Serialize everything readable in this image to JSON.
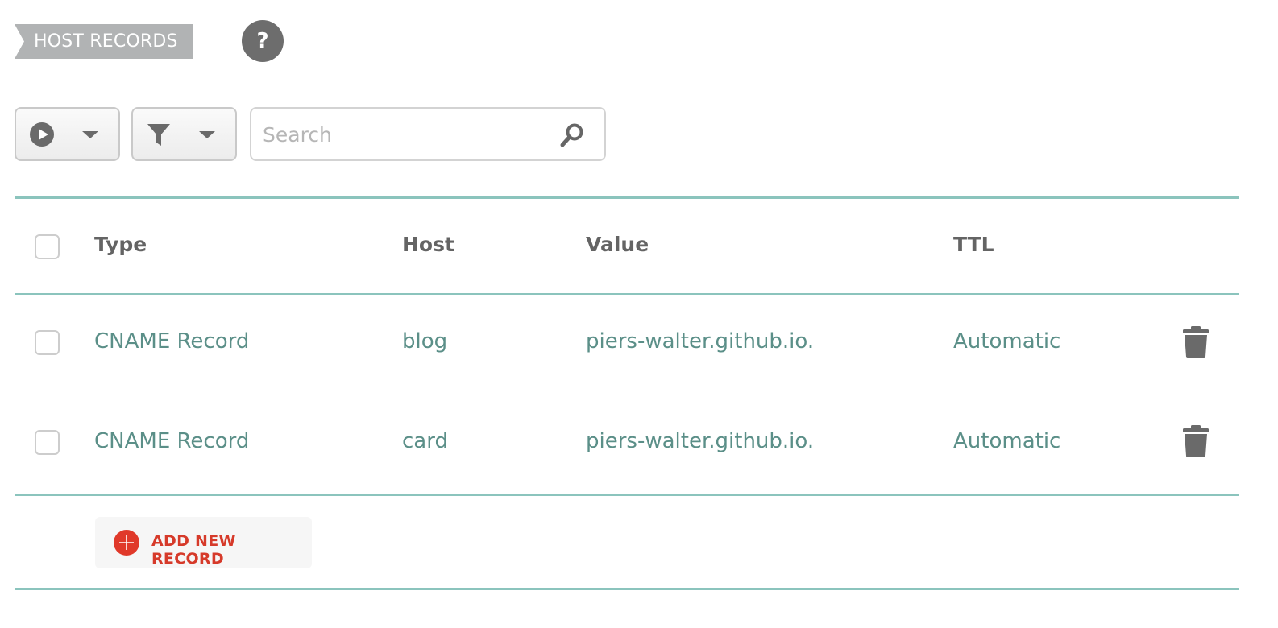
{
  "section": {
    "title": "HOST RECORDS",
    "help_label": "?"
  },
  "toolbar": {
    "actions_icon": "play-circle-icon",
    "filter_icon": "funnel-icon",
    "search": {
      "placeholder": "Search",
      "value": "",
      "icon": "search-icon"
    }
  },
  "table": {
    "columns": [
      "Type",
      "Host",
      "Value",
      "TTL"
    ],
    "rows": [
      {
        "type": "CNAME Record",
        "host": "blog",
        "value": "piers-walter.github.io.",
        "ttl": "Automatic"
      },
      {
        "type": "CNAME Record",
        "host": "card",
        "value": "piers-walter.github.io.",
        "ttl": "Automatic"
      }
    ]
  },
  "add_record": {
    "label": "ADD NEW RECORD",
    "icon": "plus-circle-icon"
  },
  "colors": {
    "accent_teal": "#8bc4bd",
    "value_text": "#5b8f88",
    "add_red": "#d63a2a",
    "tag_grey": "#b1b3b4"
  }
}
